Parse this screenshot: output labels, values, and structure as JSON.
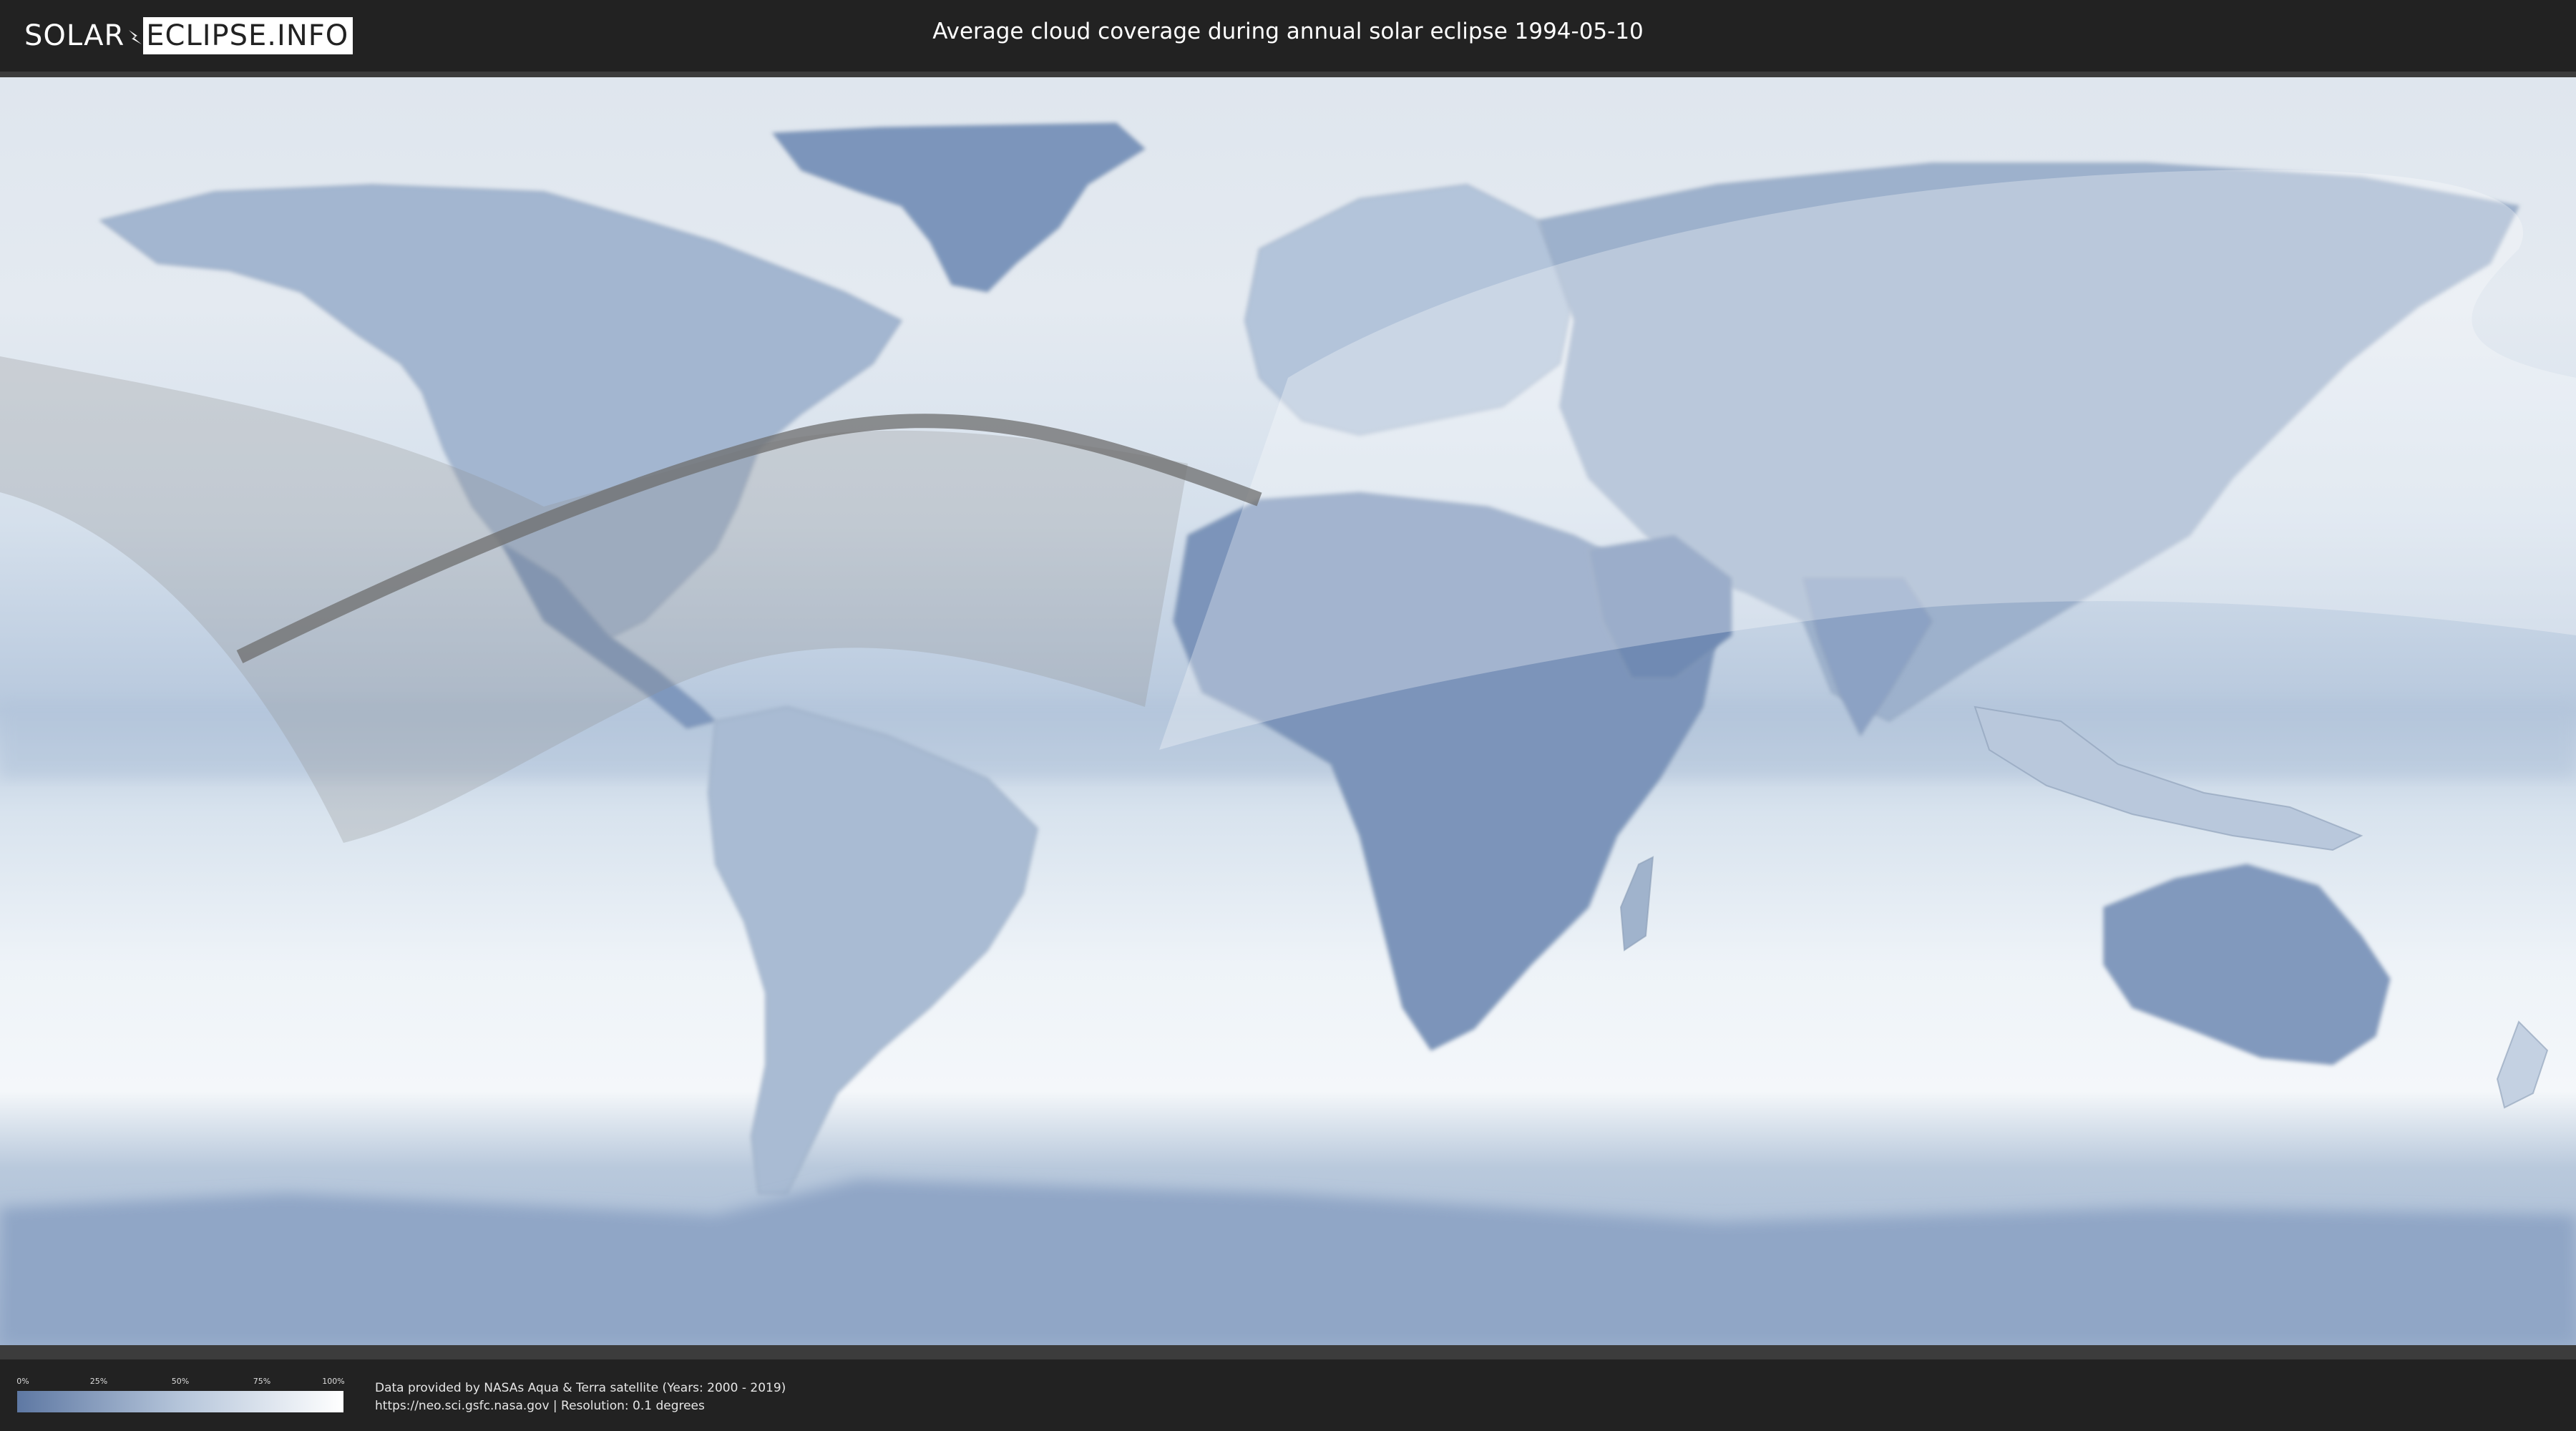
{
  "header": {
    "logo_left": "SOLAR",
    "logo_right": "ECLIPSE.INFO",
    "title": "Average cloud coverage during annual solar eclipse 1994-05-10"
  },
  "legend": {
    "ticks": [
      "0%",
      "25%",
      "50%",
      "75%",
      "100%"
    ],
    "color_min": "#5e78a3",
    "color_max": "#ffffff"
  },
  "footer": {
    "credit_line": "Data provided by NASAs Aqua & Terra satellite (Years: 2000 - 2019)",
    "source_line": "https://neo.sci.gsfc.nasa.gov | Resolution: 0.1 degrees"
  },
  "map": {
    "projection": "equirectangular",
    "ocean_color": "#e6eef5",
    "land_cloud_color": "#7d95ba",
    "path_color": "#6e6e6e"
  }
}
